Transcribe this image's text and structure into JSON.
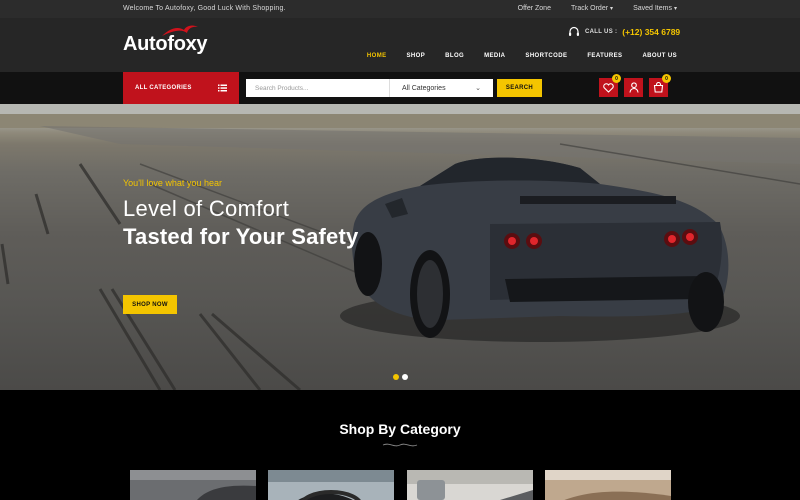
{
  "topbar": {
    "welcome": "Welcome To Autofoxy, Good Luck With Shopping.",
    "links": [
      "Offer Zone",
      "Track Order",
      "Saved Items"
    ]
  },
  "header": {
    "logo": "Autofoxy",
    "call_label": "CALL US :",
    "phone": "(+12) 354 6789",
    "nav": [
      "HOME",
      "SHOP",
      "BLOG",
      "MEDIA",
      "SHORTCODE",
      "FEATURES",
      "ABOUT US"
    ],
    "active_nav": "HOME"
  },
  "search": {
    "all_categories_label": "ALL CATEGORIES",
    "placeholder": "Search Products...",
    "category_value": "All Categories",
    "button_label": "SEARCH",
    "wishlist_count": "0",
    "cart_count": "0",
    "icons": [
      "heart-icon",
      "user-icon",
      "cart-icon"
    ]
  },
  "hero": {
    "tagline": "You'll love what you hear",
    "headline_line1": "Level of Comfort",
    "headline_line2": "Tasted for Your Safety",
    "button": "SHOP NOW",
    "slide_count": 2,
    "active_slide": 1
  },
  "categories": {
    "title": "Shop By Category"
  },
  "colors": {
    "accent": "#f4c500",
    "brand_red": "#c0121c",
    "dark_bg": "#262626"
  }
}
